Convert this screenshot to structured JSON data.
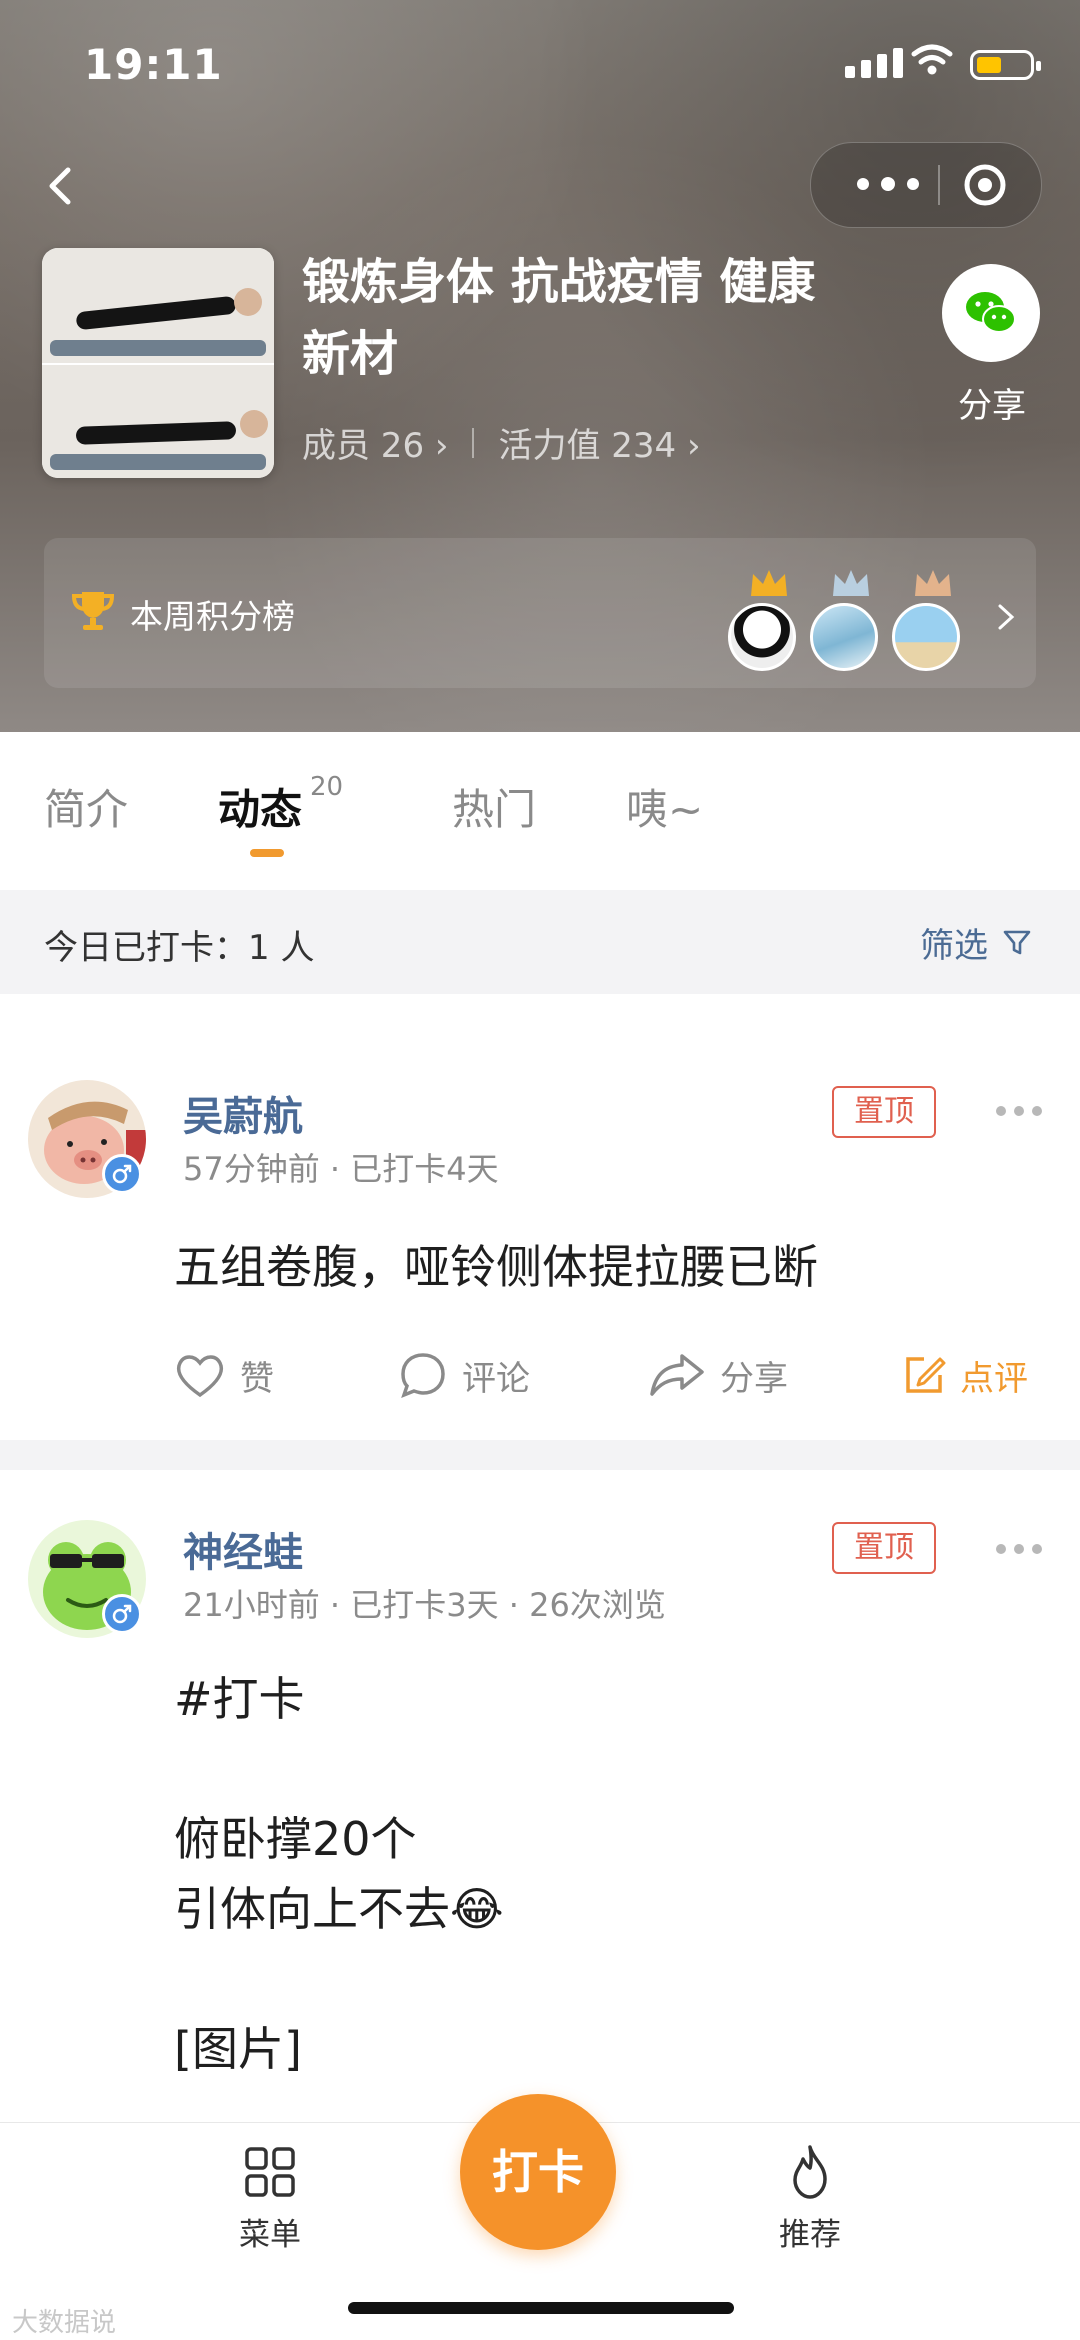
{
  "status_bar": {
    "time": "19:11"
  },
  "group": {
    "title": "锻炼身体 抗战疫情 健康新材",
    "members_label": "成员 26",
    "vitality_label": "活力值 234",
    "share_label": "分享"
  },
  "leaderboard": {
    "label": "本周积分榜"
  },
  "tabs": [
    {
      "label": "简介"
    },
    {
      "label": "动态",
      "count": "20"
    },
    {
      "label": "热门"
    },
    {
      "label": "咦~"
    }
  ],
  "checkin": {
    "summary": "今日已打卡：1 人",
    "filter_label": "筛选"
  },
  "posts": [
    {
      "user": "吴蔚航",
      "meta": "57分钟前 · 已打卡4天",
      "badge": "置顶",
      "content": "五组卷腹，哑铃侧体提拉腰已断",
      "actions": {
        "like": "赞",
        "comment": "评论",
        "share": "分享",
        "review": "点评"
      }
    },
    {
      "user": "神经蛙",
      "meta": "21小时前 · 已打卡3天 · 26次浏览",
      "badge": "置顶",
      "content": "#打卡\n\n俯卧撑20个\n引体向上不去😂\n\n[图片]"
    }
  ],
  "bottom_bar": {
    "menu": "菜单",
    "checkin": "打卡",
    "recommend": "推荐"
  },
  "watermark": "大数据说",
  "colors": {
    "accent_orange": "#f5922a",
    "link_blue": "#4a6a96",
    "pin_red": "#e0604f"
  }
}
